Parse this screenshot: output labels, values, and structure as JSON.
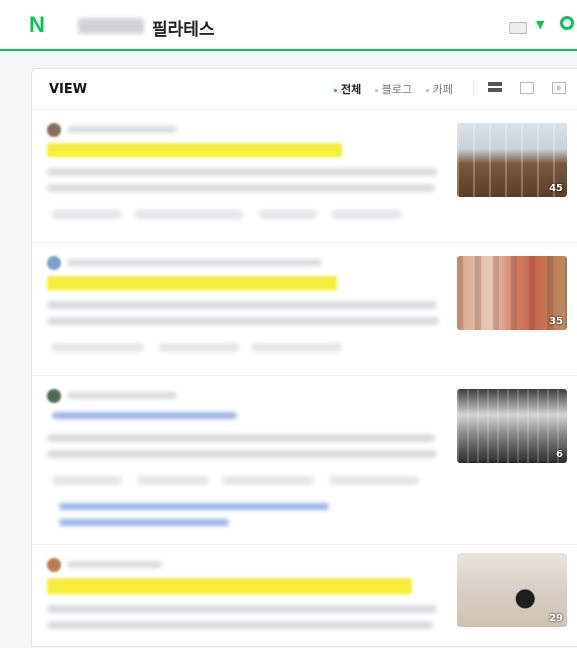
{
  "header": {
    "logo": "N",
    "query": "필라테스"
  },
  "view": {
    "title": "VIEW",
    "filters": [
      "전체",
      "블로그",
      "카페"
    ],
    "active_filter": "전체"
  },
  "results": [
    {
      "image_count": "45"
    },
    {
      "image_count": "35"
    },
    {
      "image_count": "6"
    },
    {
      "image_count": "29"
    }
  ],
  "colors": {
    "brand": "#03c75a",
    "highlight": "#f7ee3b"
  }
}
